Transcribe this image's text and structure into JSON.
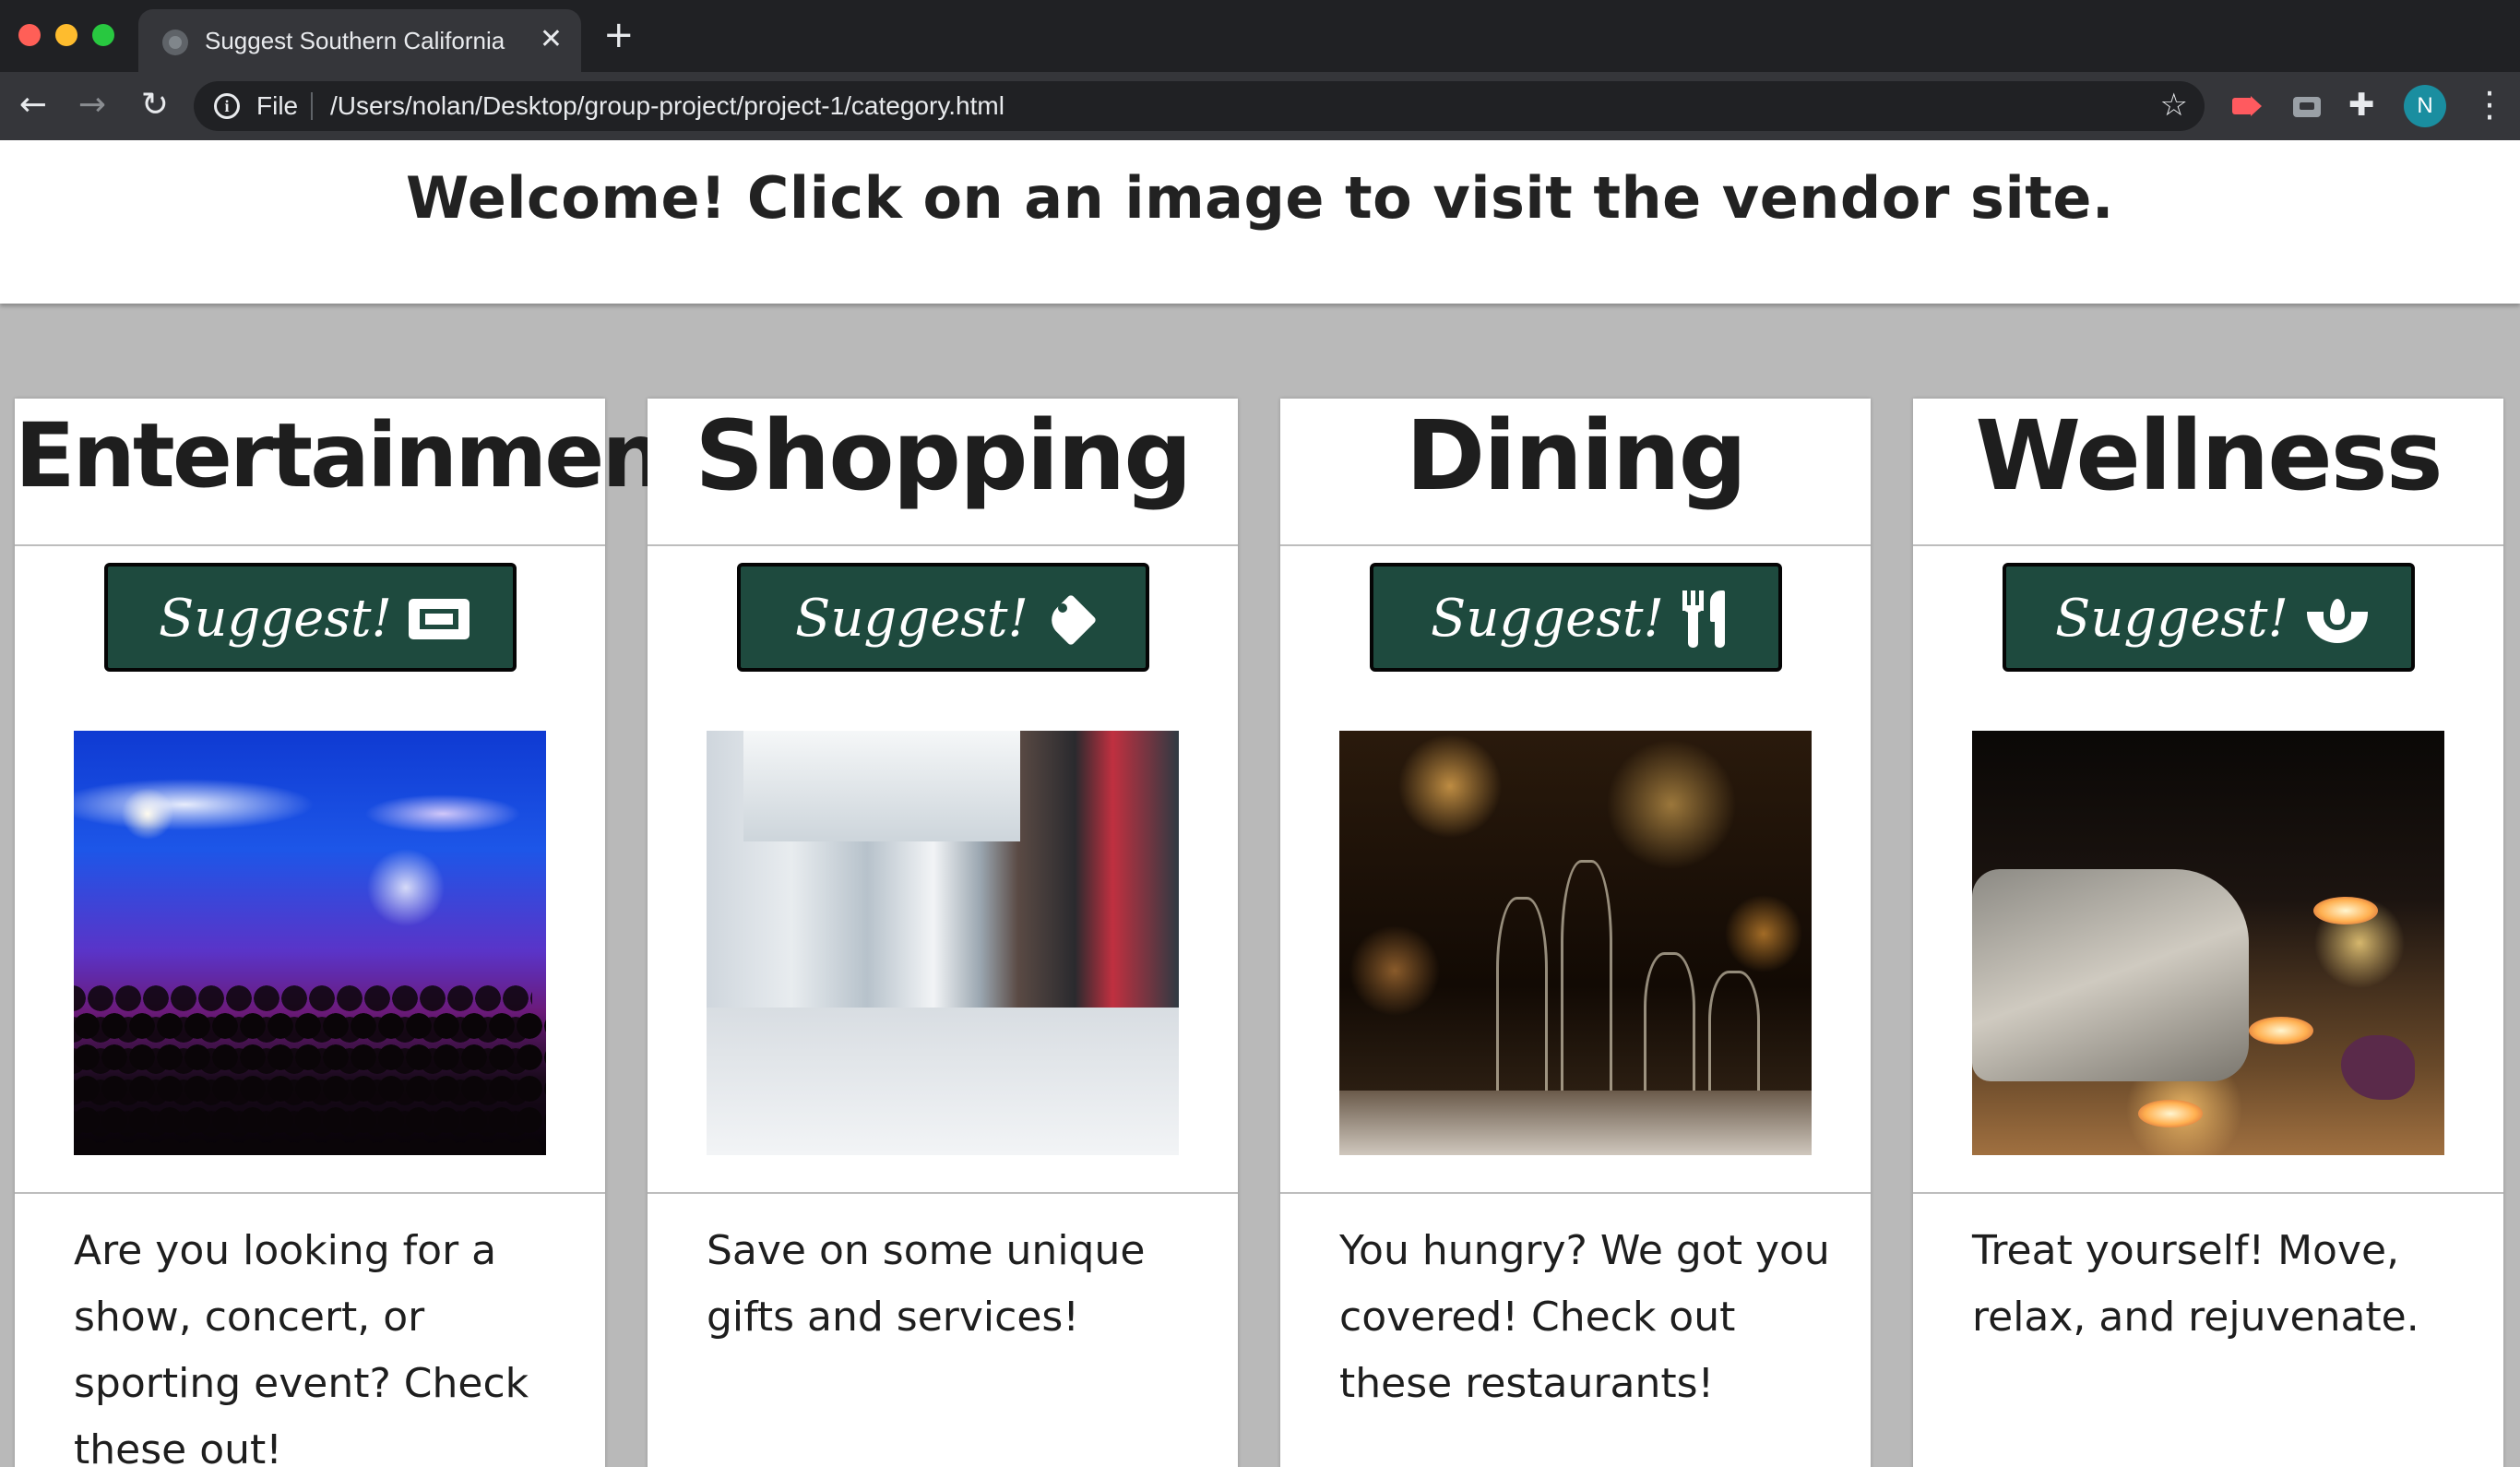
{
  "browser": {
    "tab_title": "Suggest Southern California",
    "tab_close_glyph": "✕",
    "new_tab_glyph": "+",
    "scheme_label": "File",
    "url": "/Users/nolan/Desktop/group-project/project-1/category.html",
    "profile_initial": "N",
    "icons": {
      "back": "arrow-left-icon",
      "forward": "arrow-right-icon",
      "reload": "reload-icon",
      "info": "info-icon",
      "star": "star-icon",
      "extensions": "puzzle-icon",
      "menu": "kebab-menu-icon"
    },
    "colors": {
      "frame": "#202124",
      "toolbar": "#35363a",
      "avatar": "#1a8ea0"
    }
  },
  "header": {
    "welcome": "Welcome! Click on an image to visit the vendor site."
  },
  "theme": {
    "button_bg": "#1e4a3e",
    "button_text": "#ffffff",
    "page_bg": "#b9b9b9"
  },
  "cards": [
    {
      "title": "Entertainment",
      "button_label": "Suggest!",
      "button_icon": "ticket-icon",
      "image": "concert-crowd-image",
      "text": "Are you looking for a show, concert, or sporting event? Check these out!"
    },
    {
      "title": "Shopping",
      "button_label": "Suggest!",
      "button_icon": "tag-icon",
      "image": "shopping-mall-image",
      "text": "Save on some unique gifts and services!"
    },
    {
      "title": "Dining",
      "button_label": "Suggest!",
      "button_icon": "utensils-icon",
      "image": "restaurant-table-image",
      "text": "You hungry? We got you covered! Check out these restaurants!"
    },
    {
      "title": "Wellness",
      "button_label": "Suggest!",
      "button_icon": "spa-lotus-icon",
      "image": "spa-towels-candles-image",
      "text": "Treat yourself! Move, relax, and rejuvenate."
    }
  ]
}
